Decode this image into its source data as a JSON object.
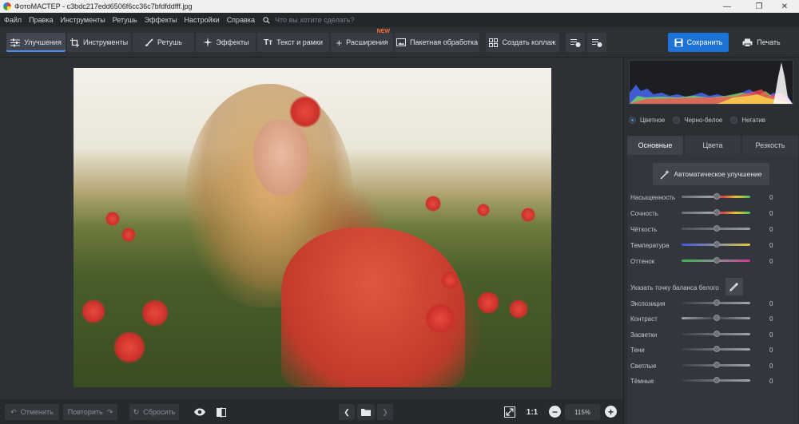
{
  "window": {
    "title": "ФотоМАСТЕР - c3bdc217edd6506f6cc36c7bfdfddfff.jpg"
  },
  "menu": {
    "items": [
      "Файл",
      "Правка",
      "Инструменты",
      "Ретушь",
      "Эффекты",
      "Настройки",
      "Справка"
    ],
    "search_placeholder": "Что вы хотите сделать?"
  },
  "toolbar": {
    "tabs": [
      {
        "label": "Улучшения",
        "icon": "sliders-icon",
        "active": true
      },
      {
        "label": "Инструменты",
        "icon": "crop-icon"
      },
      {
        "label": "Ретушь",
        "icon": "brush-icon"
      },
      {
        "label": "Эффекты",
        "icon": "sparkle-icon"
      },
      {
        "label": "Текст и рамки",
        "icon": "text-icon"
      },
      {
        "label": "Расширения",
        "icon": "plus-icon",
        "badge": "NEW"
      }
    ],
    "batch_label": "Пакетная обработка",
    "collage_label": "Создать коллаж",
    "save_label": "Сохранить",
    "print_label": "Печать"
  },
  "bottom": {
    "undo_label": "Отменить",
    "redo_label": "Повторить",
    "reset_label": "Сбросить",
    "ratio_label": "1:1",
    "zoom": "115%"
  },
  "panel": {
    "color_modes": [
      {
        "label": "Цветное",
        "selected": true
      },
      {
        "label": "Черно-белое",
        "selected": false
      },
      {
        "label": "Негатив",
        "selected": false
      }
    ],
    "tabs": [
      "Основные",
      "Цвета",
      "Резкость"
    ],
    "auto_label": "Автоматическое улучшение",
    "wb_label": "Указать точку баланса белого",
    "sliders_top": [
      {
        "label": "Насыщенность",
        "value": "0"
      },
      {
        "label": "Сочность",
        "value": "0"
      },
      {
        "label": "Чёткость",
        "value": "0"
      },
      {
        "label": "Температура",
        "value": "0"
      },
      {
        "label": "Оттенок",
        "value": "0"
      }
    ],
    "sliders_bottom": [
      {
        "label": "Экспозиция",
        "value": "0"
      },
      {
        "label": "Контраст",
        "value": "0"
      },
      {
        "label": "Засветки",
        "value": "0"
      },
      {
        "label": "Тени",
        "value": "0"
      },
      {
        "label": "Светлые",
        "value": "0"
      },
      {
        "label": "Тёмные",
        "value": "0"
      }
    ]
  },
  "colors": {
    "accent": "#1e73d6",
    "active_radio": "#3b8ef0",
    "new_badge": "#ff6f3c"
  }
}
